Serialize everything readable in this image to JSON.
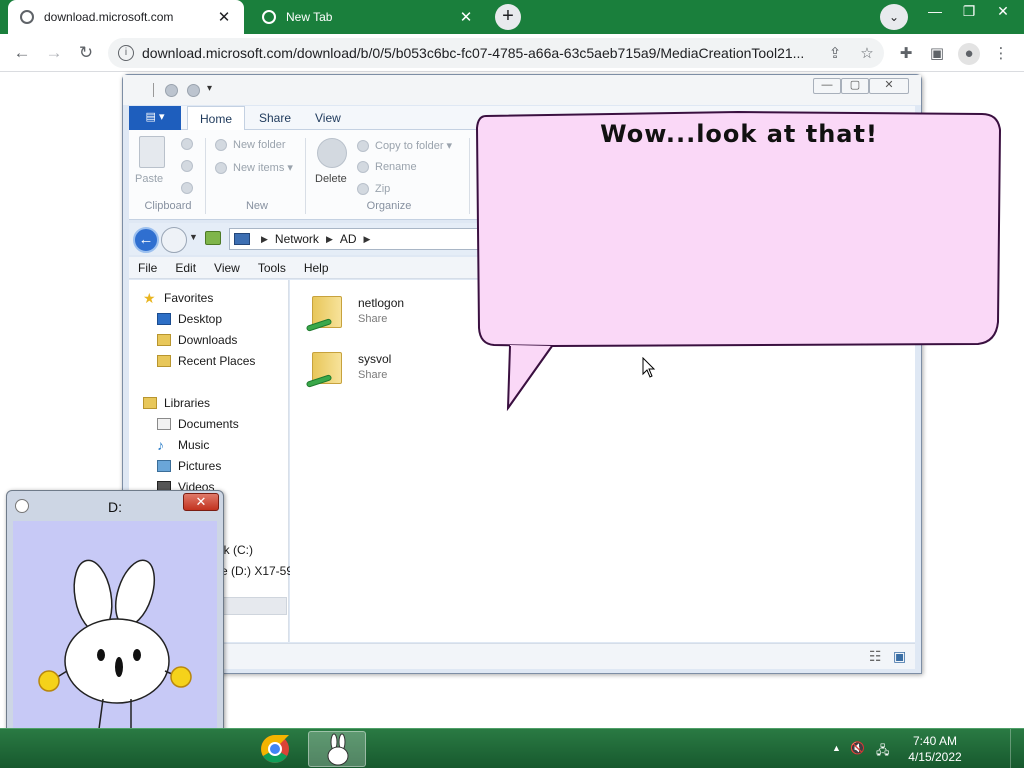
{
  "browser": {
    "tabs": [
      {
        "title": "download.microsoft.com",
        "active": true
      },
      {
        "title": "New Tab",
        "active": false
      }
    ],
    "tab_close_glyph": "✕",
    "new_tab_glyph": "+",
    "tab_search_glyph": "⌄",
    "window_controls": {
      "minimize": "—",
      "maximize": "❐",
      "close": "✕"
    },
    "nav": {
      "back": "←",
      "forward": "→",
      "reload": "↻"
    },
    "url": "download.microsoft.com/download/b/0/5/b053c6bc-fc07-4785-a66a-63c5aeb715a9/MediaCreationTool21...",
    "omnibox_icons": {
      "share": "⇪",
      "bookmark": "☆"
    },
    "toolbar_icons": {
      "extensions": "✚",
      "sidepanel": "▣",
      "profile": "●",
      "menu": "⋮"
    }
  },
  "explorer": {
    "title_controls": {
      "minimize": "—",
      "maximize": "▢",
      "close": "✕"
    },
    "ribbon_tabs": [
      "Home",
      "Share",
      "View"
    ],
    "file_button": "▤ ▾",
    "groups": {
      "clipboard": {
        "label": "Clipboard",
        "paste": "Paste"
      },
      "new": {
        "label": "New",
        "new_folder": "New folder",
        "new_items": "New items ▾"
      },
      "organize": {
        "label": "Organize",
        "delete": "Delete",
        "copy_to": "Copy to folder ▾",
        "rename": "Rename",
        "zip": "Zip"
      }
    },
    "breadcrumb": [
      "Network",
      "AD"
    ],
    "menu": [
      "File",
      "Edit",
      "View",
      "Tools",
      "Help"
    ],
    "nav": {
      "favorites": "Favorites",
      "fav_items": [
        "Desktop",
        "Downloads",
        "Recent Places"
      ],
      "libraries": "Libraries",
      "lib_items": [
        "Documents",
        "Music",
        "Pictures",
        "Videos"
      ],
      "partial": [
        "isk (C:)",
        "ve (D:) X17-59"
      ]
    },
    "items": [
      {
        "name": "netlogon",
        "type": "Share"
      },
      {
        "name": "sysvol",
        "type": "Share"
      }
    ],
    "status_icons": {
      "details": "☷",
      "large": "▣"
    }
  },
  "bubble": {
    "text": "Wow...look at that!",
    "color": "#fad8f7"
  },
  "bunny_window": {
    "title": "D:",
    "close": "✕",
    "canvas_color": "#c7c9f6"
  },
  "taskbar": {
    "tray": {
      "arrow": "▲",
      "speaker": "🔇",
      "network": "🖧"
    },
    "time": "7:40 AM",
    "date": "4/15/2022"
  }
}
